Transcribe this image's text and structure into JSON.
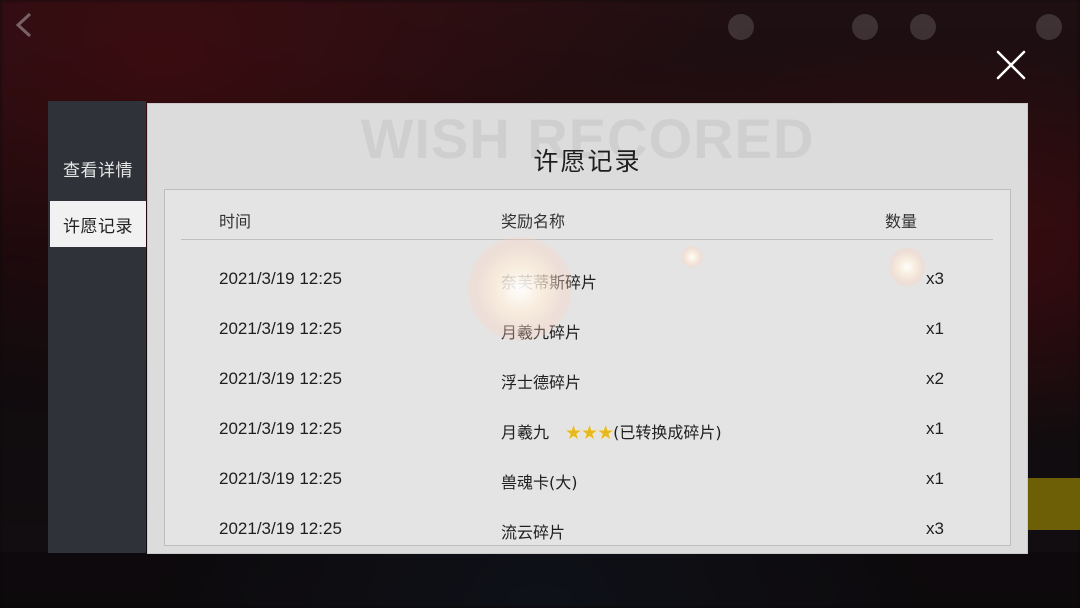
{
  "sidebar": {
    "items": [
      {
        "label": "查看详情"
      },
      {
        "label": "许愿记录"
      }
    ]
  },
  "panel": {
    "watermark": "WISH RECORED",
    "title": "许愿记录",
    "columns": {
      "time": "时间",
      "name": "奖励名称",
      "qty": "数量"
    },
    "rows": [
      {
        "time": "2021/3/19 12:25",
        "name": "奈芙蒂斯碎片",
        "qty": "x3"
      },
      {
        "time": "2021/3/19 12:25",
        "name": "月羲九碎片",
        "qty": "x1"
      },
      {
        "time": "2021/3/19 12:25",
        "name": "浮士德碎片",
        "qty": "x2"
      },
      {
        "time": "2021/3/19 12:25",
        "name": "月羲九",
        "stars": "★★★",
        "note": "(已转换成碎片)",
        "qty": "x1"
      },
      {
        "time": "2021/3/19 12:25",
        "name": "兽魂卡(大)",
        "qty": "x1"
      },
      {
        "time": "2021/3/19 12:25",
        "name": "流云碎片",
        "qty": "x3"
      }
    ]
  },
  "icons": {
    "close": "close-icon",
    "back": "back-arrow-icon"
  },
  "colors": {
    "sidebar_bg": "#2f3239",
    "panel_bg": "#dcdcdc",
    "star": "#e8b820"
  }
}
